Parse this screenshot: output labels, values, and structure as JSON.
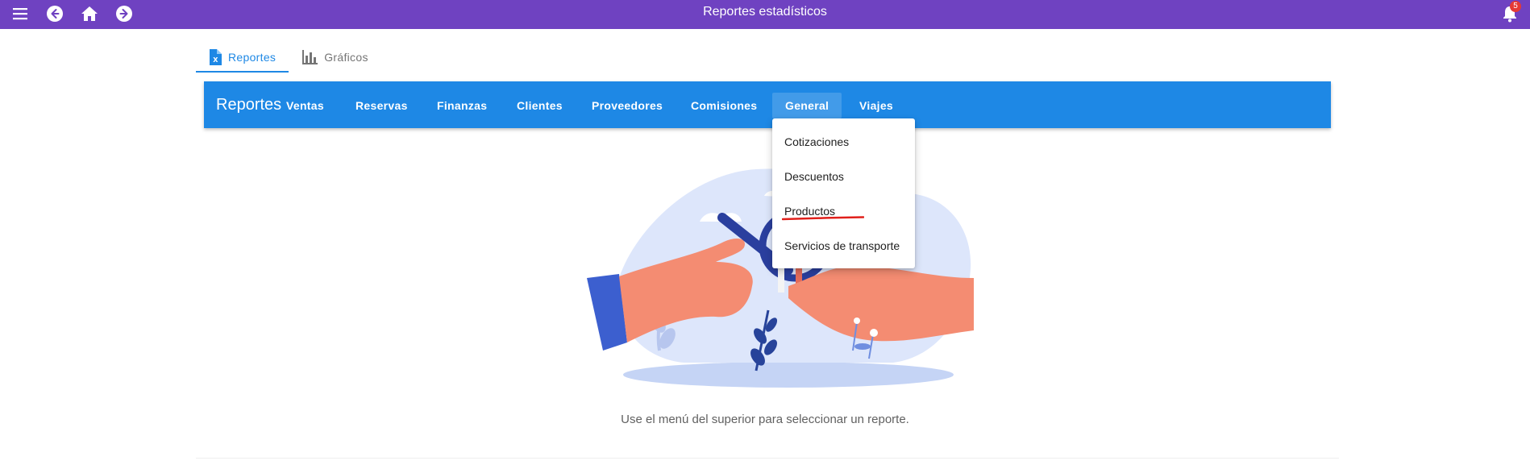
{
  "appbar": {
    "title": "Reportes estadísticos",
    "notification_count": "5",
    "color": "#6f42c1"
  },
  "tabs": [
    {
      "label": "Reportes",
      "icon": "excel-file-icon",
      "active": true
    },
    {
      "label": "Gráficos",
      "icon": "bar-chart-icon",
      "active": false
    }
  ],
  "toolbar": {
    "brand": "Reportes",
    "color": "#1e88e5",
    "menus": [
      {
        "label": "Ventas"
      },
      {
        "label": "Reservas"
      },
      {
        "label": "Finanzas"
      },
      {
        "label": "Clientes"
      },
      {
        "label": "Proveedores"
      },
      {
        "label": "Comisiones"
      },
      {
        "label": "General"
      },
      {
        "label": "Viajes"
      }
    ]
  },
  "dropdown": {
    "items": [
      {
        "label": "Cotizaciones"
      },
      {
        "label": "Descuentos"
      },
      {
        "label": "Productos"
      },
      {
        "label": "Servicios de transporte"
      }
    ]
  },
  "hint": "Use el menú del superior para seleccionar un reporte."
}
